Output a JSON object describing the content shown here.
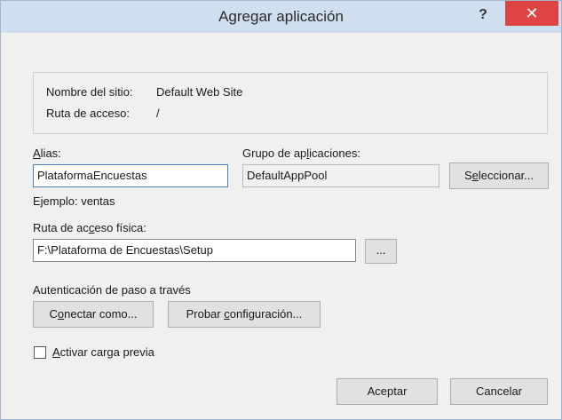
{
  "window": {
    "title": "Agregar aplicación",
    "help_label": "?",
    "close_label": "✕"
  },
  "site_info": {
    "site_name_label": "Nombre del sitio:",
    "site_name_value": "Default Web Site",
    "path_label": "Ruta de acceso:",
    "path_value": "/"
  },
  "alias": {
    "label_prefix": "",
    "label_accel": "A",
    "label_rest": "lias:",
    "value": "PlataformaEncuestas",
    "example": "Ejemplo: ventas"
  },
  "app_pool": {
    "label_prefix": "Grupo de ap",
    "label_accel": "l",
    "label_rest": "icaciones:",
    "value": "DefaultAppPool",
    "select_prefix": "S",
    "select_accel": "e",
    "select_rest": "leccionar..."
  },
  "physical_path": {
    "label_prefix": "Ruta de ac",
    "label_accel": "c",
    "label_rest": "eso física:",
    "value": "F:\\Plataforma de Encuestas\\Setup",
    "browse_label": "..."
  },
  "passthrough": {
    "label": "Autenticación de paso a través",
    "connect_prefix": "C",
    "connect_accel": "o",
    "connect_rest": "nectar como...",
    "test_prefix": "Probar ",
    "test_accel": "c",
    "test_rest": "onfiguración..."
  },
  "preload": {
    "label_accel": "A",
    "label_rest": "ctivar carga previa",
    "checked": false
  },
  "footer": {
    "ok_label": "Aceptar",
    "cancel_label": "Cancelar"
  }
}
